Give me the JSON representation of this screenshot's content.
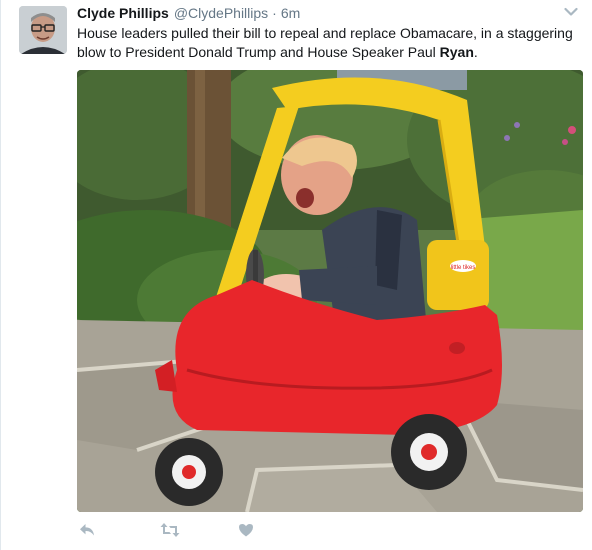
{
  "tweet": {
    "fullname": "Clyde Phillips",
    "username": "@ClydePhillips",
    "separator": "·",
    "time": "6m",
    "text_main": "House leaders pulled their bill to repeal and replace Obamacare, in a staggering blow to President Donald Trump and House Speaker Paul ",
    "text_bold": "Ryan",
    "text_end": "."
  },
  "media": {
    "toy_brand": "little tikes"
  },
  "icons": {
    "avatar": "avatar-photo",
    "caret": "chevron-down-icon",
    "reply": "reply-icon",
    "retweet": "retweet-icon",
    "like": "heart-icon"
  },
  "colors": {
    "icon_gray": "#aab8c2",
    "text": "#14171a",
    "secondary": "#657786",
    "car_red": "#e8262b",
    "roof_yellow": "#f4cd1f"
  }
}
